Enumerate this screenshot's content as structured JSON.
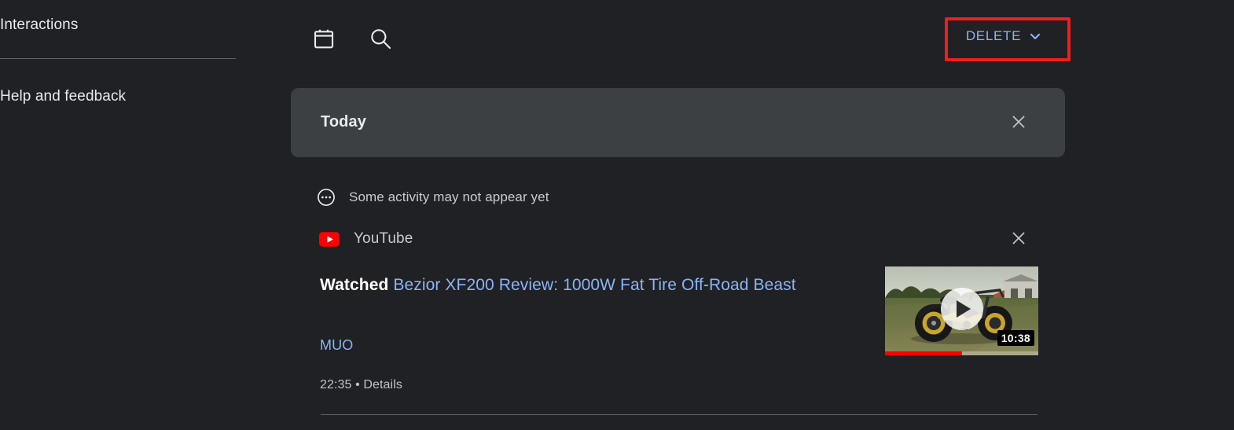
{
  "sidebar": {
    "items": [
      {
        "label": "Interactions",
        "name": "sidebar-item-interactions"
      },
      {
        "label": "Help and feedback",
        "name": "sidebar-item-help-and-feedback"
      }
    ]
  },
  "toolbar": {
    "calendar_icon": "calendar-icon",
    "search_icon": "search-icon",
    "delete_label": "DELETE",
    "delete_chevron_icon": "chevron-down-icon",
    "highlight_color": "#f41c1c",
    "link_color": "#8ab4f8"
  },
  "banner": {
    "title": "Today",
    "close_icon": "close-icon"
  },
  "notice": {
    "icon": "pending-dots-icon",
    "text": "Some activity may not appear yet"
  },
  "entry": {
    "source_icon": "youtube-icon",
    "source_name": "YouTube",
    "close_icon": "close-icon",
    "action": "Watched",
    "title": "Bezior XF200 Review: 1000W Fat Tire Off-Road Beast",
    "channel": "MUO",
    "time": "22:35",
    "separator": "•",
    "details_label": "Details",
    "thumbnail": {
      "duration": "10:38",
      "progress_percent": 50,
      "play_icon": "play-icon",
      "alt": "Fat tire electric bike standing in a grassy field beside a building"
    }
  },
  "colors": {
    "page_background": "#202124",
    "banner_background": "#3c4043",
    "link": "#8ab4f8",
    "youtube_red": "#ff0000",
    "highlight_red": "#f41c1c",
    "divider": "#5f6368"
  }
}
